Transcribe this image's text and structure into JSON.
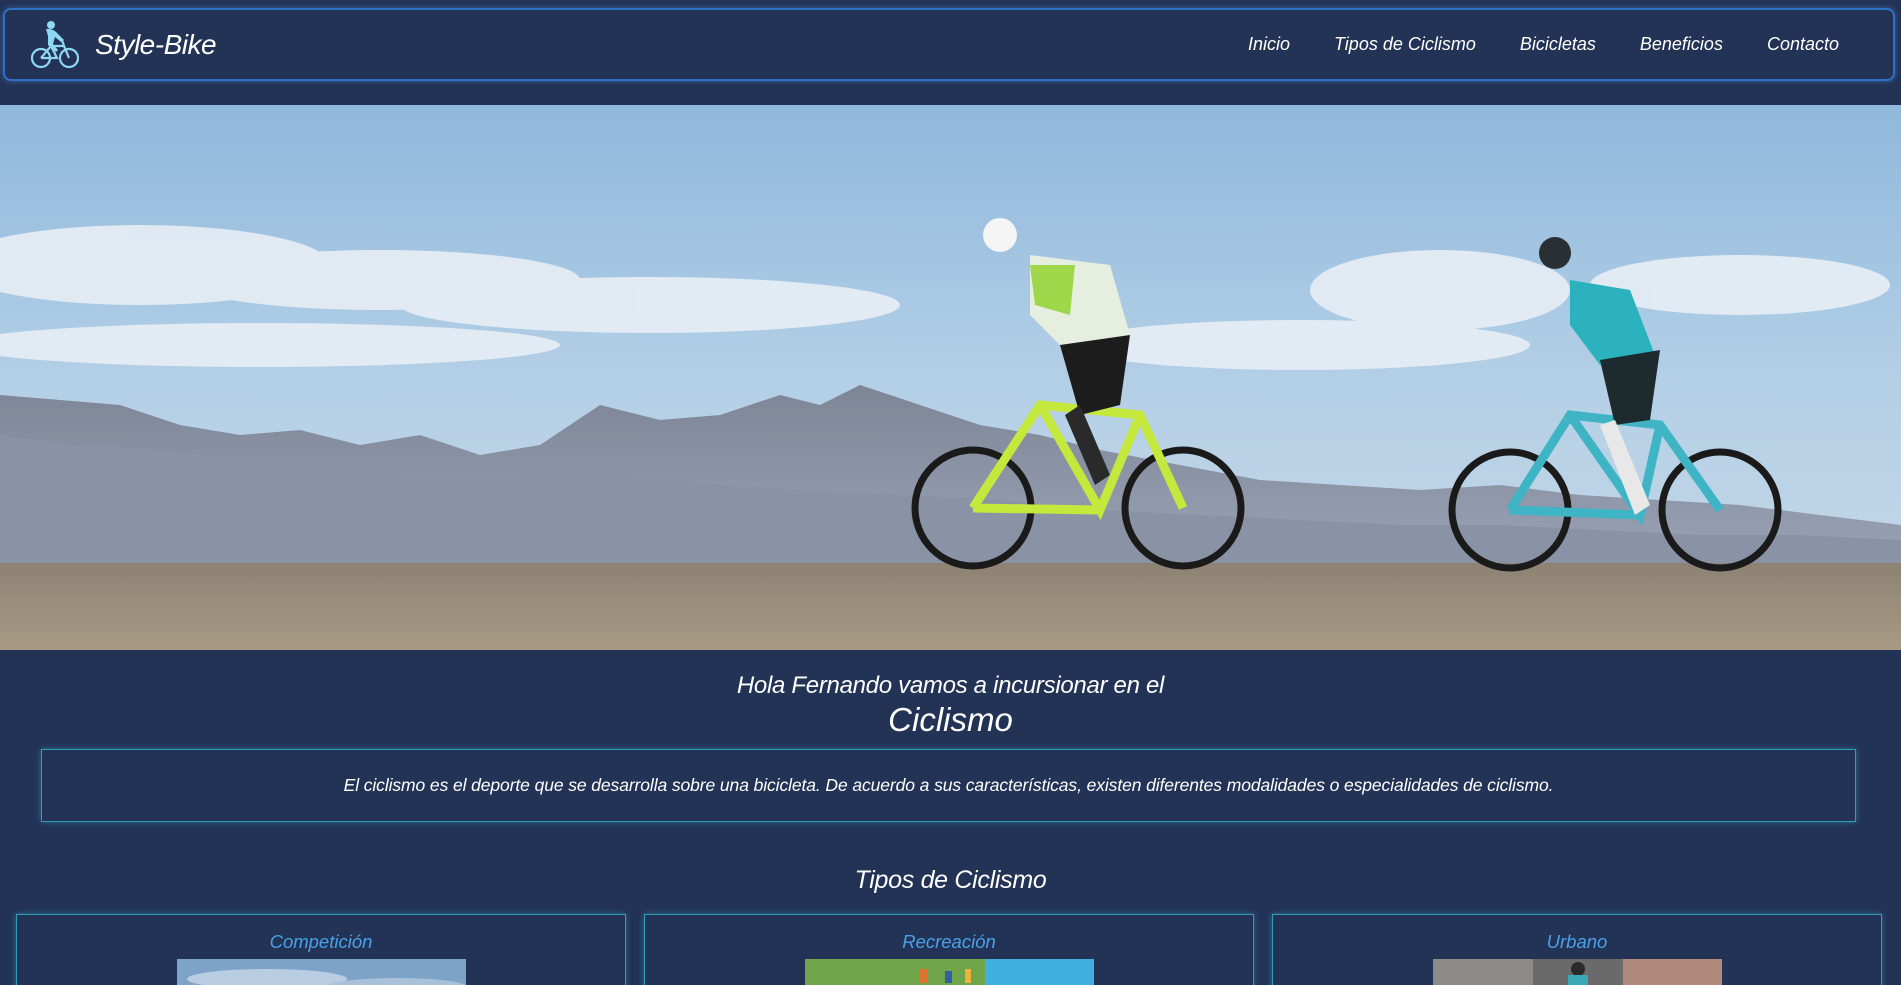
{
  "navbar": {
    "brand": "Style-Bike",
    "logo_icon": "cyclist-logo-icon",
    "links": [
      "Inicio",
      "Tipos de Ciclismo",
      "Bicicletas",
      "Beneficios",
      "Contacto"
    ]
  },
  "hero": {
    "image": "two-cyclists-mountain-road-photo"
  },
  "intro": {
    "greeting": "Hola Fernando vamos a incursionar en el",
    "greeting_big": "Ciclismo",
    "description": "El ciclismo es el deporte que se desarrolla sobre una bicicleta. De acuerdo a sus características, existen diferentes modalidades o especialidades de ciclismo."
  },
  "types_section": {
    "title": "Tipos de Ciclismo",
    "cards": [
      {
        "title": "Competición",
        "image": "competition-cycling-photo"
      },
      {
        "title": "Recreación",
        "image": "recreation-cycling-photo"
      },
      {
        "title": "Urbano",
        "image": "urban-cycling-photo"
      }
    ]
  },
  "colors": {
    "background": "#233356",
    "nav_border": "#2f6fc4",
    "box_border": "#2f9fb8",
    "card_title": "#4aa0e8"
  }
}
